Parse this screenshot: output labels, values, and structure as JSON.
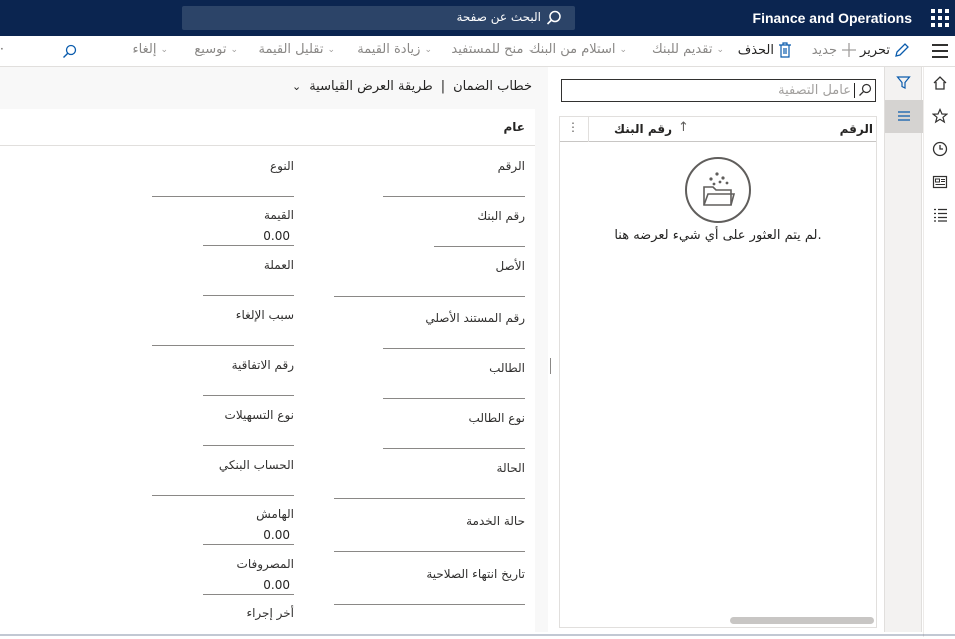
{
  "header": {
    "app_title": "Finance and Operations",
    "search_placeholder": "البحث عن صفحة"
  },
  "action_pane": {
    "edit": "تحرير",
    "new": "جديد",
    "delete": "الحذف",
    "submit_to_bank": "تقديم للبنك",
    "receive_from_bank": "استلام من البنك",
    "grant_to_beneficiary": "منح للمستفيد",
    "increase_value": "زيادة القيمة",
    "decrease_value": "تقليل القيمة",
    "extend": "توسيع",
    "cancel": "إلغاء"
  },
  "list": {
    "filter_placeholder": "عامل التصفية",
    "columns": [
      "الرقم",
      "رقم البنك"
    ],
    "empty_message": "لم يتم العثور على أي شيء لعرضه هنا."
  },
  "details": {
    "breadcrumb": "خطاب الضمان",
    "view_selector": "طريقة العرض القياسية",
    "section_title": "عام",
    "right_fields": [
      {
        "label": "الرقم",
        "value": ""
      },
      {
        "label": "رقم البنك",
        "value": ""
      },
      {
        "label": "الأصل",
        "value": ""
      },
      {
        "label": "رقم المستند الأصلي",
        "value": ""
      },
      {
        "label": "الطالب",
        "value": ""
      },
      {
        "label": "نوع الطالب",
        "value": ""
      },
      {
        "label": "الحالة",
        "value": ""
      },
      {
        "label": "حالة الخدمة",
        "value": ""
      },
      {
        "label": "تاريخ انتهاء الصلاحية",
        "value": ""
      }
    ],
    "left_fields": [
      {
        "label": "النوع",
        "value": ""
      },
      {
        "label": "القيمة",
        "value": "0.00"
      },
      {
        "label": "العملة",
        "value": ""
      },
      {
        "label": "سبب الإلغاء",
        "value": ""
      },
      {
        "label": "رقم الاتفاقية",
        "value": ""
      },
      {
        "label": "نوع التسهيلات",
        "value": ""
      },
      {
        "label": "الحساب البنكي",
        "value": ""
      },
      {
        "label": "الهامش",
        "value": "0.00"
      },
      {
        "label": "المصروفات",
        "value": "0.00"
      },
      {
        "label": "أخر إجراء",
        "value": ""
      }
    ]
  }
}
